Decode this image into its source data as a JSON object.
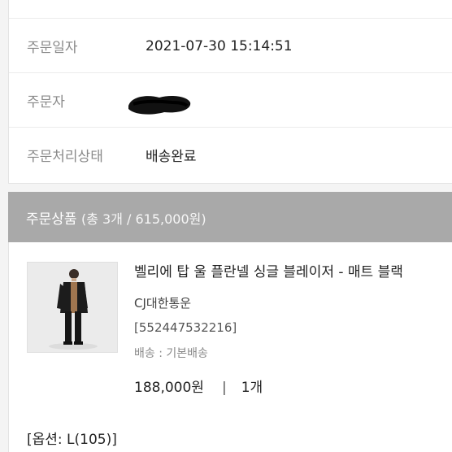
{
  "order_info": {
    "date_label": "주문일자",
    "date_value": "2021-07-30 15:14:51",
    "orderer_label": "주문자",
    "status_label": "주문처리상태",
    "status_value": "배송완료"
  },
  "order_items": {
    "title": "주문상품",
    "summary": "(총 3개 / 615,000원)"
  },
  "product": {
    "name": "벨리에 탑 울 플란넬 싱글 블레이저 - 매트 블랙",
    "carrier": "CJ대한통운",
    "tracking": "[552447532216]",
    "shipping": "배송 : 기본배송",
    "price": "188,000원",
    "separator": "|",
    "quantity": "1개",
    "option": "[옵션: L(105)]"
  },
  "colors": {
    "section_header_bg": "#a9a9a9",
    "label_gray": "#8a8a8a"
  }
}
